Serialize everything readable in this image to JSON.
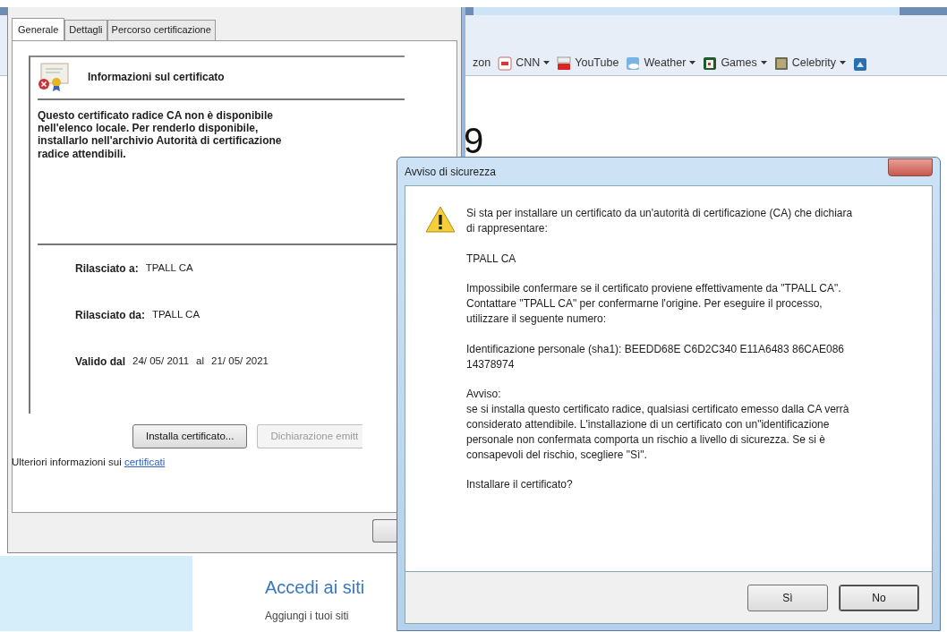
{
  "browser": {
    "bookmarks": [
      {
        "label": "zon",
        "dropdown": false
      },
      {
        "label": "CNN",
        "dropdown": true
      },
      {
        "label": "YouTube",
        "dropdown": false
      },
      {
        "label": "Weather",
        "dropdown": true
      },
      {
        "label": "Games",
        "dropdown": true
      },
      {
        "label": "Celebrity",
        "dropdown": true
      }
    ],
    "page_text_fragment": "9",
    "section_title": "Accedi ai siti",
    "section_text": "Aggiungi i tuoi siti"
  },
  "certificate_dialog": {
    "tabs": [
      {
        "label": "Generale",
        "selected": true
      },
      {
        "label": "Dettagli",
        "selected": false
      },
      {
        "label": "Percorso certificazione",
        "selected": false
      }
    ],
    "header": "Informazioni sul certificato",
    "message": "Questo certificato radice CA non è disponibile nell'elenco locale. Per renderlo disponibile, installarlo nell'archivio Autorità di certificazione radice attendibili.",
    "fields": [
      {
        "label": "Rilasciato a:",
        "value": "TPALL CA"
      },
      {
        "label": "Rilasciato da:",
        "value": "TPALL CA"
      },
      {
        "label": "Valido dal",
        "value": "24/ 05/ 2011",
        "connector": "al",
        "value_end": "21/ 05/ 2021"
      }
    ],
    "buttons": [
      {
        "label": "Installa certificato...",
        "disabled": false
      },
      {
        "label": "Dichiarazione emitt",
        "disabled": true
      }
    ],
    "footer_text": "Ulteriori informazioni sui",
    "footer_link": "certificati"
  },
  "security_dialog": {
    "title": "Avviso di sicurezza",
    "paragraphs": [
      {
        "kind": "text",
        "text": "Si sta per installare un certificato da un'autorità di certificazione (CA) che dichiara di rappresentare:"
      },
      {
        "kind": "text",
        "text": "TPALL CA"
      },
      {
        "kind": "text",
        "text": "Impossibile confermare se il certificato proviene effettivamente da \"TPALL CA\". Contattare \"TPALL CA\" per confermarne l'origine. Per eseguire il processo, utilizzare il seguente numero:"
      },
      {
        "kind": "text",
        "text": "Identificazione personale (sha1): BEEDD68E C6D2C340 E11A6483 86CAE086 14378974"
      },
      {
        "kind": "label",
        "text": "Avviso:"
      },
      {
        "kind": "text",
        "text": "se si installa questo certificato radice, qualsiasi certificato emesso dalla CA verrà considerato attendibile. L'installazione di un certificato con un\"identificazione personale non confermata comporta un rischio a livello di sicurezza. Se si è consapevoli del rischio, scegliere \"Sì\"."
      },
      {
        "kind": "text",
        "text": "Installare il certificato?"
      }
    ],
    "buttons": [
      {
        "label": "Sì",
        "selected": false
      },
      {
        "label": "No",
        "selected": true
      }
    ]
  }
}
